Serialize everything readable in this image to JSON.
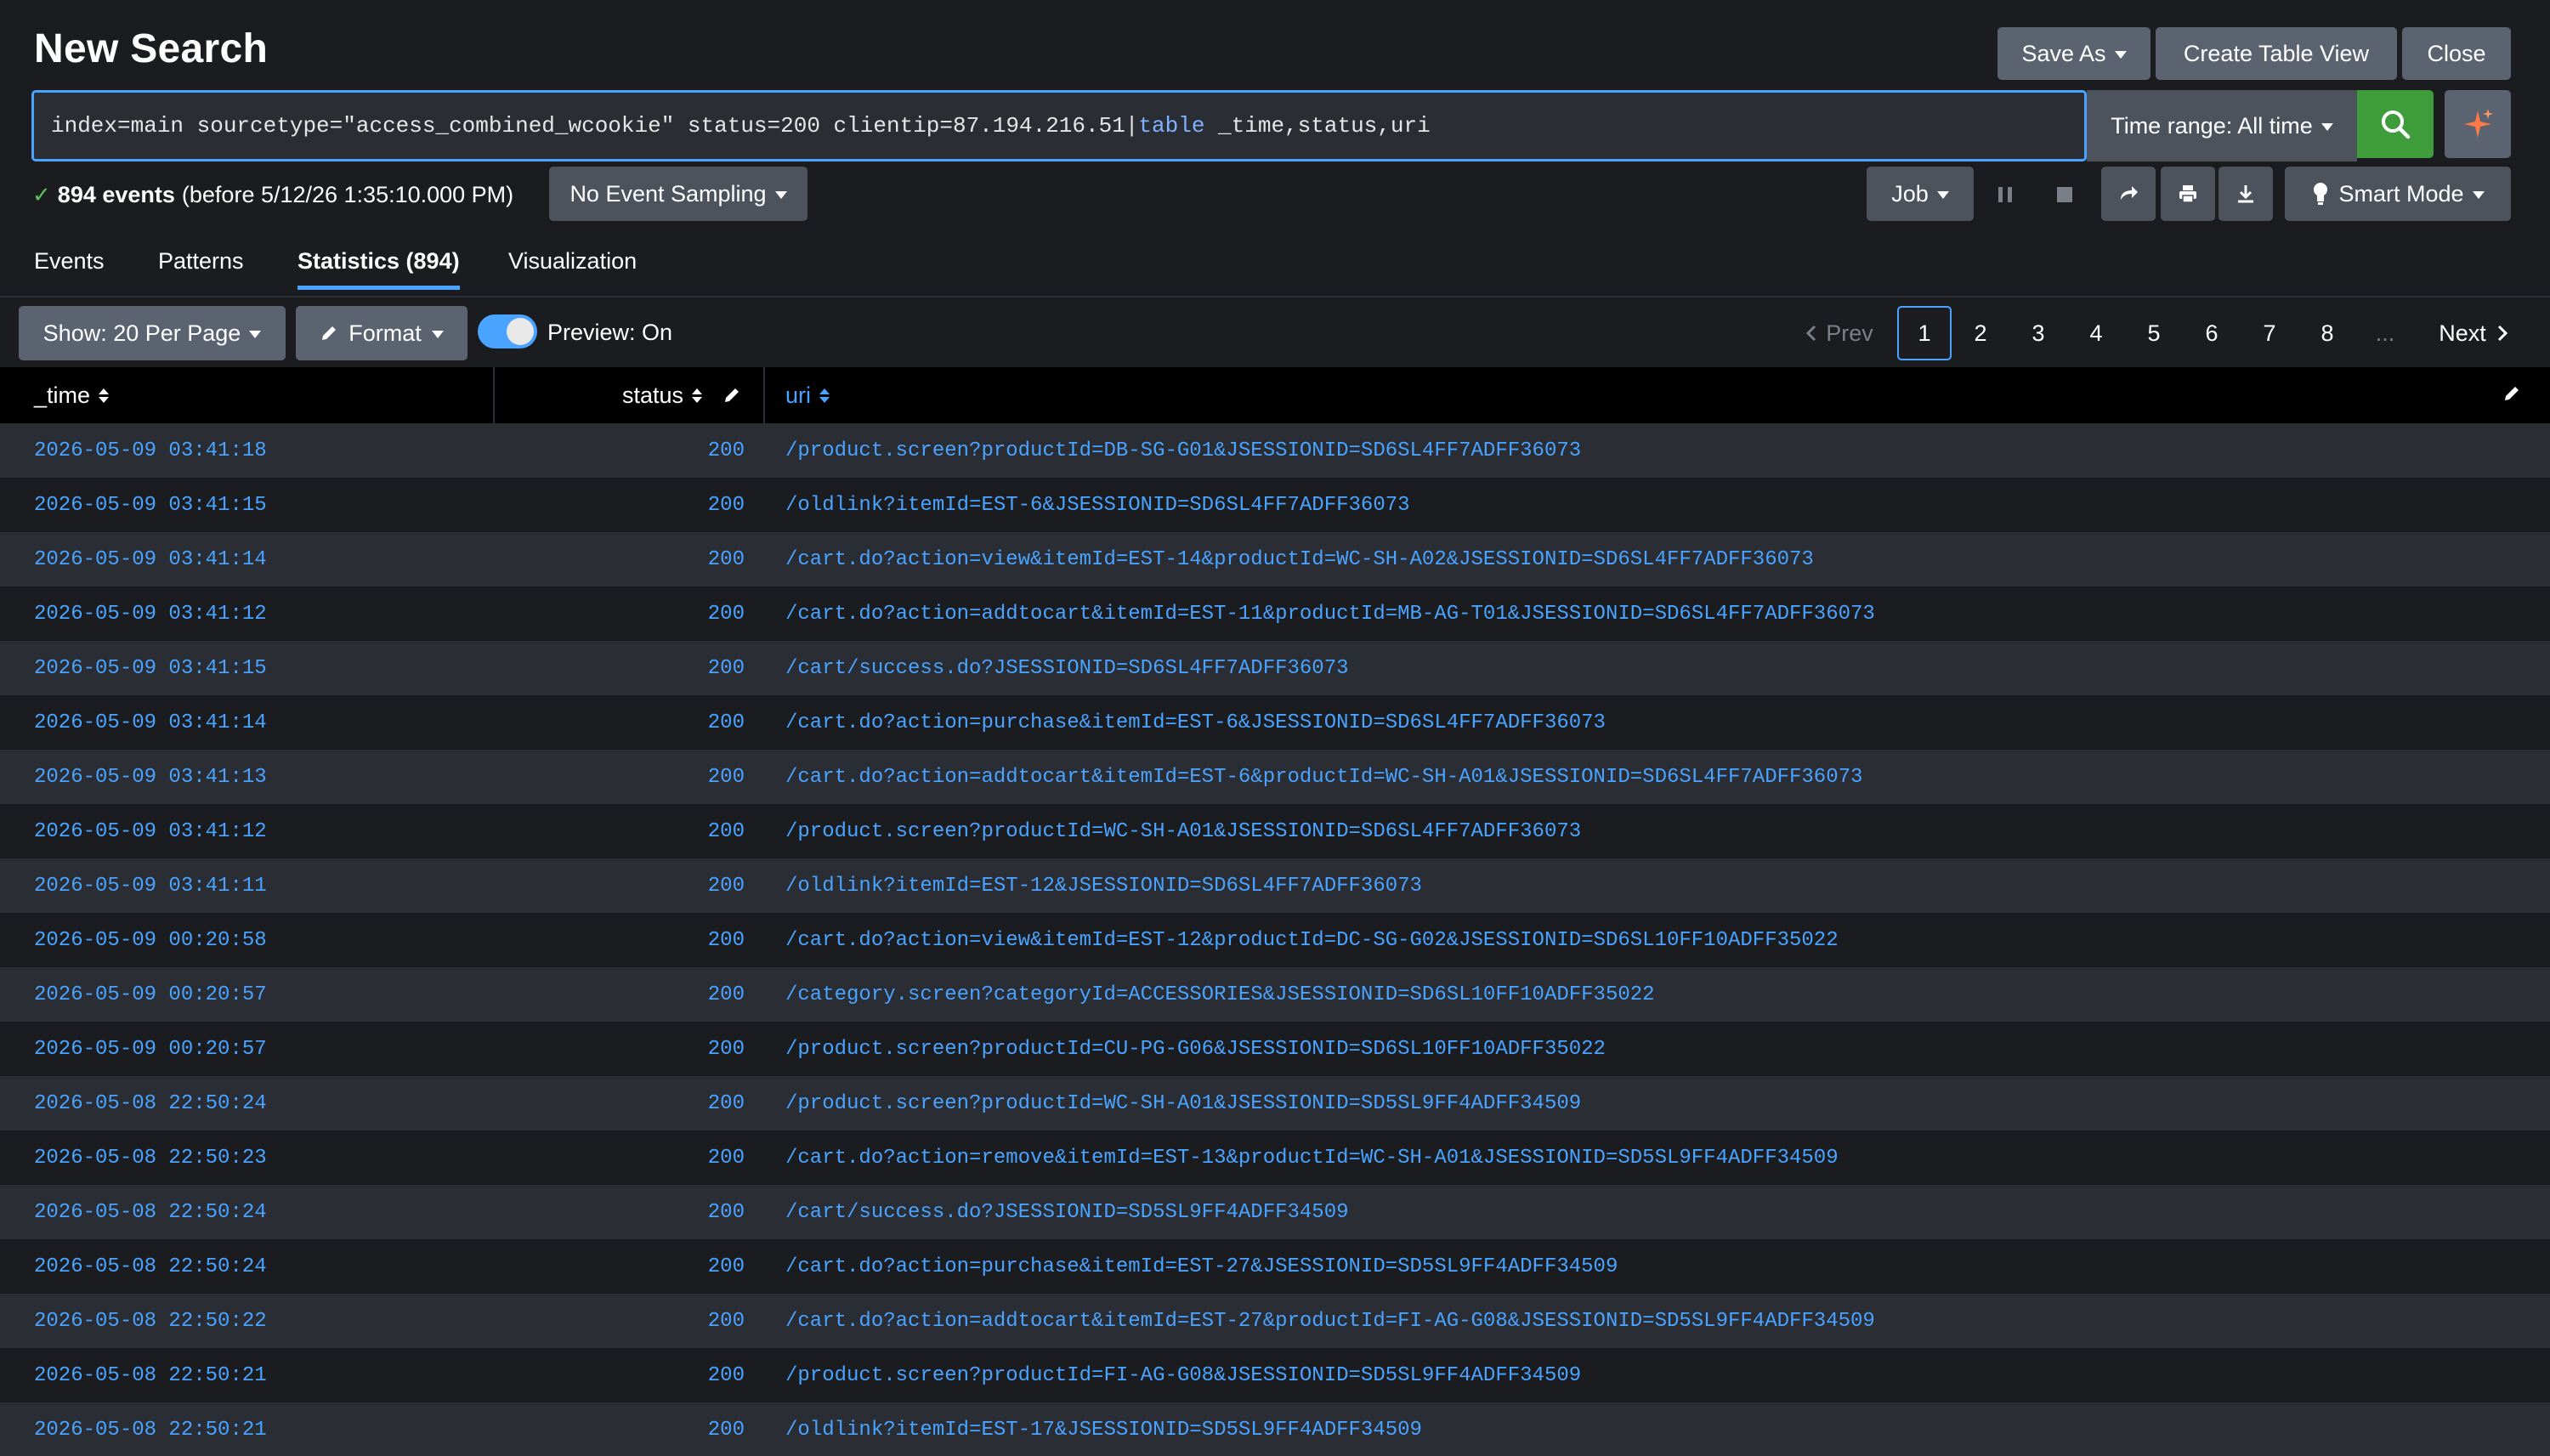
{
  "header": {
    "title": "New Search",
    "save_as_label": "Save As",
    "create_table_label": "Create Table View",
    "close_label": "Close"
  },
  "search": {
    "query_prefix": "index=main sourcetype=\"access_combined_wcookie\" status=200 clientip=87.194.216.51|",
    "query_command": "table",
    "query_suffix": " _time,status,uri",
    "time_range_label": "Time range: All time"
  },
  "status_bar": {
    "events_count": "894 events",
    "events_detail": "(before 5/12/26 1:35:10.000 PM)",
    "sampling_label": "No Event Sampling",
    "job_label": "Job",
    "smart_mode_label": "Smart Mode"
  },
  "tabs": [
    {
      "label": "Events",
      "active": false
    },
    {
      "label": "Patterns",
      "active": false
    },
    {
      "label": "Statistics (894)",
      "active": true
    },
    {
      "label": "Visualization",
      "active": false
    }
  ],
  "controls": {
    "show_label": "Show: 20 Per Page",
    "format_label": "Format",
    "preview_label": "Preview: On",
    "preview_on": true
  },
  "pagination": {
    "prev_label": "Prev",
    "next_label": "Next",
    "pages": [
      "1",
      "2",
      "3",
      "4",
      "5",
      "6",
      "7",
      "8"
    ],
    "current_page": "1",
    "ellipsis": "..."
  },
  "table": {
    "columns": [
      "_time",
      "status",
      "uri"
    ],
    "rows": [
      {
        "time": "2026-05-09 03:41:18",
        "status": "200",
        "uri": "/product.screen?productId=DB-SG-G01&JSESSIONID=SD6SL4FF7ADFF36073"
      },
      {
        "time": "2026-05-09 03:41:15",
        "status": "200",
        "uri": "/oldlink?itemId=EST-6&JSESSIONID=SD6SL4FF7ADFF36073"
      },
      {
        "time": "2026-05-09 03:41:14",
        "status": "200",
        "uri": "/cart.do?action=view&itemId=EST-14&productId=WC-SH-A02&JSESSIONID=SD6SL4FF7ADFF36073"
      },
      {
        "time": "2026-05-09 03:41:12",
        "status": "200",
        "uri": "/cart.do?action=addtocart&itemId=EST-11&productId=MB-AG-T01&JSESSIONID=SD6SL4FF7ADFF36073"
      },
      {
        "time": "2026-05-09 03:41:15",
        "status": "200",
        "uri": "/cart/success.do?JSESSIONID=SD6SL4FF7ADFF36073"
      },
      {
        "time": "2026-05-09 03:41:14",
        "status": "200",
        "uri": "/cart.do?action=purchase&itemId=EST-6&JSESSIONID=SD6SL4FF7ADFF36073"
      },
      {
        "time": "2026-05-09 03:41:13",
        "status": "200",
        "uri": "/cart.do?action=addtocart&itemId=EST-6&productId=WC-SH-A01&JSESSIONID=SD6SL4FF7ADFF36073"
      },
      {
        "time": "2026-05-09 03:41:12",
        "status": "200",
        "uri": "/product.screen?productId=WC-SH-A01&JSESSIONID=SD6SL4FF7ADFF36073"
      },
      {
        "time": "2026-05-09 03:41:11",
        "status": "200",
        "uri": "/oldlink?itemId=EST-12&JSESSIONID=SD6SL4FF7ADFF36073"
      },
      {
        "time": "2026-05-09 00:20:58",
        "status": "200",
        "uri": "/cart.do?action=view&itemId=EST-12&productId=DC-SG-G02&JSESSIONID=SD6SL10FF10ADFF35022"
      },
      {
        "time": "2026-05-09 00:20:57",
        "status": "200",
        "uri": "/category.screen?categoryId=ACCESSORIES&JSESSIONID=SD6SL10FF10ADFF35022"
      },
      {
        "time": "2026-05-09 00:20:57",
        "status": "200",
        "uri": "/product.screen?productId=CU-PG-G06&JSESSIONID=SD6SL10FF10ADFF35022"
      },
      {
        "time": "2026-05-08 22:50:24",
        "status": "200",
        "uri": "/product.screen?productId=WC-SH-A01&JSESSIONID=SD5SL9FF4ADFF34509"
      },
      {
        "time": "2026-05-08 22:50:23",
        "status": "200",
        "uri": "/cart.do?action=remove&itemId=EST-13&productId=WC-SH-A01&JSESSIONID=SD5SL9FF4ADFF34509"
      },
      {
        "time": "2026-05-08 22:50:24",
        "status": "200",
        "uri": "/cart/success.do?JSESSIONID=SD5SL9FF4ADFF34509"
      },
      {
        "time": "2026-05-08 22:50:24",
        "status": "200",
        "uri": "/cart.do?action=purchase&itemId=EST-27&JSESSIONID=SD5SL9FF4ADFF34509"
      },
      {
        "time": "2026-05-08 22:50:22",
        "status": "200",
        "uri": "/cart.do?action=addtocart&itemId=EST-27&productId=FI-AG-G08&JSESSIONID=SD5SL9FF4ADFF34509"
      },
      {
        "time": "2026-05-08 22:50:21",
        "status": "200",
        "uri": "/product.screen?productId=FI-AG-G08&JSESSIONID=SD5SL9FF4ADFF34509"
      },
      {
        "time": "2026-05-08 22:50:21",
        "status": "200",
        "uri": "/oldlink?itemId=EST-17&JSESSIONID=SD5SL9FF4ADFF34509"
      }
    ]
  },
  "colors": {
    "accent": "#4aa3ff",
    "search_button": "#3e9c3a",
    "ai_sparkle": "#ff7a45",
    "background": "#1a1c20"
  },
  "icons": {
    "search": "magnifier-icon",
    "ai": "sparkle-icon",
    "share": "share-icon",
    "print": "print-icon",
    "export": "download-icon",
    "smart_mode": "lightbulb-icon",
    "format": "pencil-icon"
  }
}
